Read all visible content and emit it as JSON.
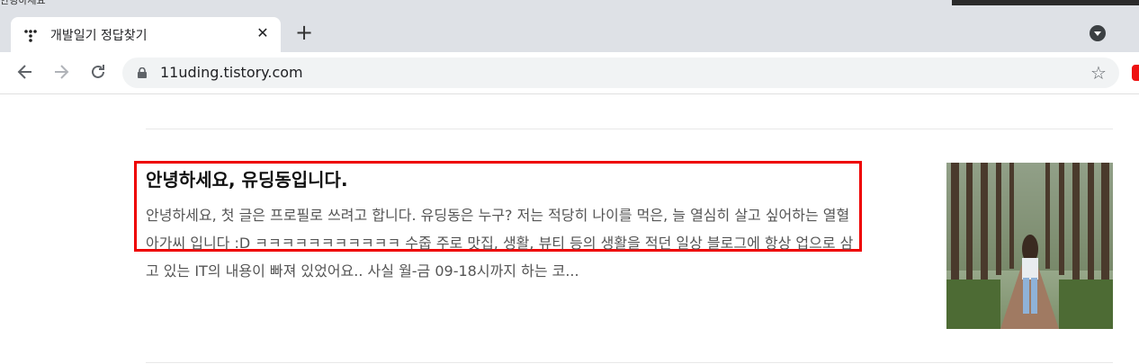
{
  "window": {
    "top_fragment": "안녕하세요"
  },
  "tabs": [
    {
      "title": "개발일기 정답찾기",
      "favicon": "tistory-icon"
    }
  ],
  "toolbar": {
    "url": "11uding.tistory.com"
  },
  "post": {
    "title": "안녕하세요, 유딩동입니다.",
    "excerpt": "안녕하세요, 첫 글은 프로필로 쓰려고 합니다. 유딩동은 누구? 저는 적당히 나이를 먹은, 늘 열심히 살고 싶어하는 열혈아가씨 입니다 :D ㅋㅋㅋㅋㅋㅋㅋㅋㅋㅋㅋ 수줍 주로 맛집, 생활, 뷰티 등의 생활을 적던 일상 블로그에 항상 업으로 삼고 있는 IT의 내용이 빠져 있었어요.. 사실 월-금 09-18시까지 하는 코..."
  },
  "colors": {
    "highlight": "#e00000",
    "tab_bar": "#dee1e6",
    "omnibox": "#f1f3f4"
  }
}
